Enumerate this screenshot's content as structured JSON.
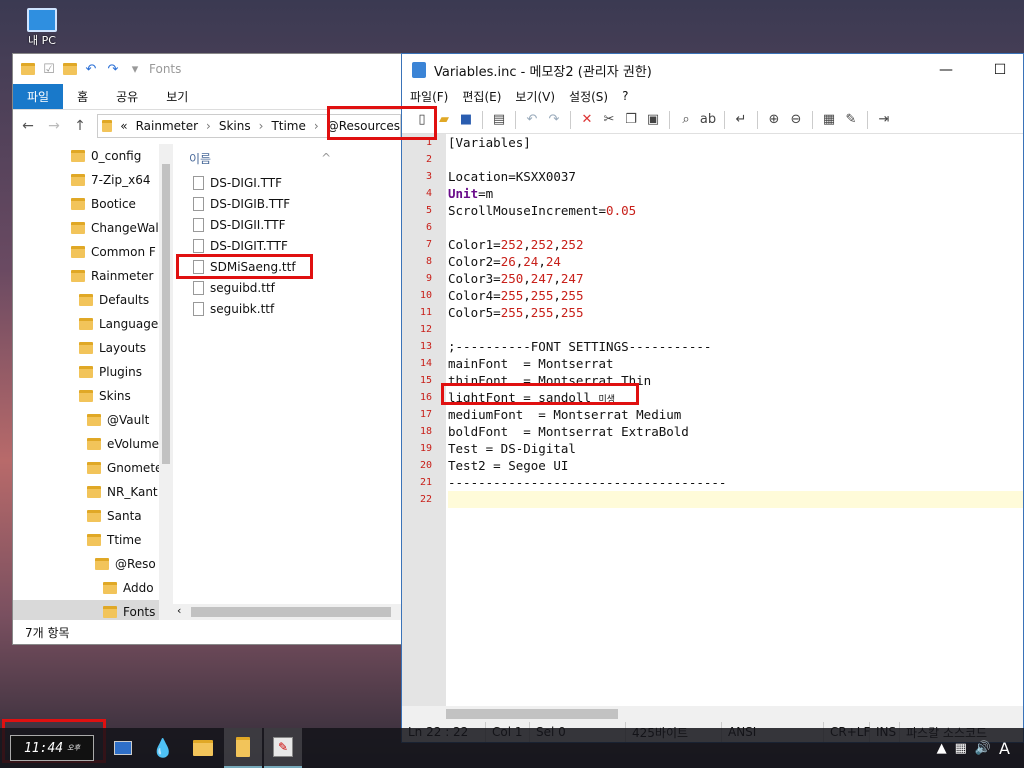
{
  "desktop": {
    "icon_label": "내 PC"
  },
  "explorer": {
    "title": "Fonts",
    "ribbon_tabs": [
      "파일",
      "홈",
      "공유",
      "보기"
    ],
    "breadcrumbs": [
      "«",
      "Rainmeter",
      "Skins",
      "Ttime",
      "@Resources"
    ],
    "tree": [
      {
        "label": "0_config",
        "indent": 0
      },
      {
        "label": "7-Zip_x64",
        "indent": 0
      },
      {
        "label": "Bootice",
        "indent": 0
      },
      {
        "label": "ChangeWal",
        "indent": 0
      },
      {
        "label": "Common F",
        "indent": 0
      },
      {
        "label": "Rainmeter",
        "indent": 0
      },
      {
        "label": "Defaults",
        "indent": 1
      },
      {
        "label": "Languages",
        "indent": 1
      },
      {
        "label": "Layouts",
        "indent": 1
      },
      {
        "label": "Plugins",
        "indent": 1
      },
      {
        "label": "Skins",
        "indent": 1
      },
      {
        "label": "@Vault",
        "indent": 2
      },
      {
        "label": "eVolume",
        "indent": 2
      },
      {
        "label": "Gnomete",
        "indent": 2
      },
      {
        "label": "NR_Kant",
        "indent": 2
      },
      {
        "label": "Santa",
        "indent": 2
      },
      {
        "label": "Ttime",
        "indent": 2
      },
      {
        "label": "@Reso",
        "indent": 3
      },
      {
        "label": "Addo",
        "indent": 4
      },
      {
        "label": "Fonts",
        "indent": 4
      }
    ],
    "column_header": "이름",
    "files": [
      "DS-DIGI.TTF",
      "DS-DIGIB.TTF",
      "DS-DIGII.TTF",
      "DS-DIGIT.TTF",
      "SDMiSaeng.ttf",
      "seguibd.ttf",
      "seguibk.ttf"
    ],
    "status": "7개 항목"
  },
  "notepad": {
    "title": "Variables.inc - 메모장2 (관리자 권한)",
    "menu": [
      "파일(F)",
      "편집(E)",
      "보기(V)",
      "설정(S)",
      "?"
    ],
    "lines": [
      "[Variables]",
      "",
      "Location=KSXX0037",
      "Unit=m",
      "ScrollMouseIncrement=0.05",
      "",
      "Color1=252,252,252",
      "Color2=26,24,24",
      "Color3=250,247,247",
      "Color4=255,255,255",
      "Color5=255,255,255",
      "",
      ";----------FONT SETTINGS-----------",
      "mainFont  = Montserrat",
      "thinFont  = Montserrat Thin",
      "lightFont = sandoll 미생",
      "mediumFont  = Montserrat Medium",
      "boldFont  = Montserrat ExtraBold",
      "Test = DS-Digital",
      "Test2 = Segoe UI",
      "-------------------------------------",
      ""
    ],
    "status": {
      "position": "Ln 22 : 22",
      "col": "Col 1",
      "sel": "Sel 0",
      "size": "425바이트",
      "encoding": "ANSI",
      "eol": "CR+LF",
      "mode": "INS",
      "scheme": "파스칼 소스코드"
    }
  },
  "taskbar": {
    "clock": "11:44",
    "clock_sub": "오후"
  },
  "colors": {
    "highlight": "#e01010",
    "accent": "#1979ca"
  }
}
